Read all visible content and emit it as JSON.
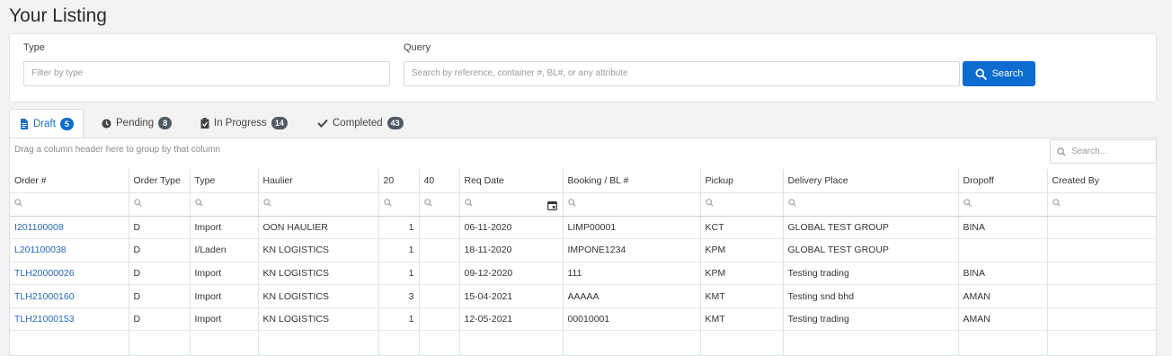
{
  "page": {
    "title": "Your Listing"
  },
  "filters": {
    "type_label": "Type",
    "type_placeholder": "Filter by type",
    "query_label": "Query",
    "query_placeholder": "Search by reference, container #, BL#, or any attribute",
    "search_button": "Search"
  },
  "tabs": [
    {
      "label": "Draft",
      "count": "5",
      "icon": "document-icon"
    },
    {
      "label": "Pending",
      "count": "8",
      "icon": "clock-icon"
    },
    {
      "label": "In Progress",
      "count": "14",
      "icon": "clipboard-check-icon"
    },
    {
      "label": "Completed",
      "count": "43",
      "icon": "checkmark-icon"
    }
  ],
  "grid": {
    "group_hint": "Drag a column header here to group by that column",
    "search_placeholder": "Search...",
    "columns": [
      "Order #",
      "Order Type",
      "Type",
      "Haulier",
      "20",
      "40",
      "Req Date",
      "Booking / BL #",
      "Pickup",
      "Delivery Place",
      "Dropoff",
      "Created By"
    ],
    "rows": [
      [
        "I201100008",
        "D",
        "Import",
        "OON HAULIER",
        "1",
        "",
        "06-11-2020",
        "LIMP00001",
        "KCT",
        "GLOBAL TEST GROUP",
        "BINA",
        ""
      ],
      [
        "L201100038",
        "D",
        "I/Laden",
        "KN LOGISTICS",
        "1",
        "",
        "18-11-2020",
        "IMPONE1234",
        "KPM",
        "GLOBAL TEST GROUP",
        "",
        ""
      ],
      [
        "TLH20000026",
        "D",
        "Import",
        "KN LOGISTICS",
        "1",
        "",
        "09-12-2020",
        "111",
        "KPM",
        "Testing trading",
        "BINA",
        ""
      ],
      [
        "TLH21000160",
        "D",
        "Import",
        "KN LOGISTICS",
        "3",
        "",
        "15-04-2021",
        "AAAAA",
        "KMT",
        "Testing snd bhd",
        "AMAN",
        ""
      ],
      [
        "TLH21000153",
        "D",
        "Import",
        "KN LOGISTICS",
        "1",
        "",
        "12-05-2021",
        "00010001",
        "KMT",
        "Testing trading",
        "AMAN",
        ""
      ]
    ]
  },
  "colors": {
    "accent": "#0d6cd0",
    "link": "#2767b8",
    "badge": "#505a64"
  }
}
